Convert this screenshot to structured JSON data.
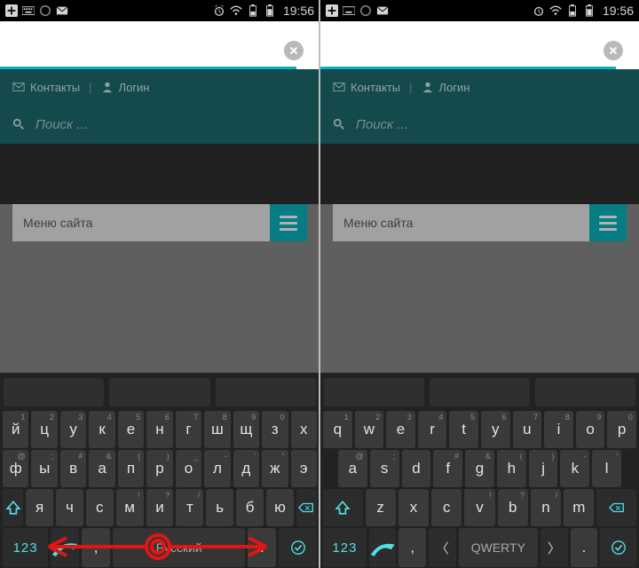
{
  "status": {
    "time": "19:56"
  },
  "browser": {
    "close": "×"
  },
  "teal": {
    "contacts": "Контакты",
    "login": "Логин",
    "search_placeholder": "Поиск ..."
  },
  "menu": {
    "label": "Меню сайта"
  },
  "left_keyboard": {
    "row1": [
      {
        "k": "й",
        "s": "1"
      },
      {
        "k": "ц",
        "s": "2"
      },
      {
        "k": "у",
        "s": "3"
      },
      {
        "k": "к",
        "s": "4"
      },
      {
        "k": "е",
        "s": "5"
      },
      {
        "k": "н",
        "s": "6"
      },
      {
        "k": "г",
        "s": "7"
      },
      {
        "k": "ш",
        "s": "8"
      },
      {
        "k": "щ",
        "s": "9"
      },
      {
        "k": "з",
        "s": "0"
      },
      {
        "k": "х",
        "s": ""
      }
    ],
    "row2": [
      {
        "k": "ф",
        "s": "@"
      },
      {
        "k": "ы",
        "s": ";"
      },
      {
        "k": "в",
        "s": "#"
      },
      {
        "k": "а",
        "s": "&"
      },
      {
        "k": "п",
        "s": "("
      },
      {
        "k": "р",
        "s": ")"
      },
      {
        "k": "о",
        "s": "_"
      },
      {
        "k": "л",
        "s": "-"
      },
      {
        "k": "д",
        "s": "'"
      },
      {
        "k": "ж",
        "s": "\""
      },
      {
        "k": "э",
        "s": ""
      }
    ],
    "row3": [
      {
        "k": "я",
        "s": ""
      },
      {
        "k": "ч",
        "s": ""
      },
      {
        "k": "с",
        "s": ""
      },
      {
        "k": "м",
        "s": "!"
      },
      {
        "k": "и",
        "s": "?"
      },
      {
        "k": "т",
        "s": "/"
      },
      {
        "k": "ь",
        "s": ""
      },
      {
        "k": "б",
        "s": ""
      },
      {
        "k": "ю",
        "s": ""
      }
    ],
    "num": "123",
    "space": "Русский",
    "comma": ",",
    "dot": "."
  },
  "right_keyboard": {
    "row1": [
      {
        "k": "q",
        "s": "1"
      },
      {
        "k": "w",
        "s": "2"
      },
      {
        "k": "e",
        "s": "3"
      },
      {
        "k": "r",
        "s": "4"
      },
      {
        "k": "t",
        "s": "5"
      },
      {
        "k": "y",
        "s": "6"
      },
      {
        "k": "u",
        "s": "7"
      },
      {
        "k": "i",
        "s": "8"
      },
      {
        "k": "o",
        "s": "9"
      },
      {
        "k": "p",
        "s": "0"
      }
    ],
    "row2": [
      {
        "k": "a",
        "s": "@"
      },
      {
        "k": "s",
        "s": ";"
      },
      {
        "k": "d",
        "s": ""
      },
      {
        "k": "f",
        "s": "#"
      },
      {
        "k": "g",
        "s": "&"
      },
      {
        "k": "h",
        "s": "("
      },
      {
        "k": "j",
        "s": ")"
      },
      {
        "k": "k",
        "s": "-"
      },
      {
        "k": "l",
        "s": "'"
      }
    ],
    "row3": [
      {
        "k": "z",
        "s": ""
      },
      {
        "k": "x",
        "s": ""
      },
      {
        "k": "c",
        "s": ""
      },
      {
        "k": "v",
        "s": "!"
      },
      {
        "k": "b",
        "s": "?"
      },
      {
        "k": "n",
        "s": "/"
      },
      {
        "k": "m",
        "s": ""
      }
    ],
    "num": "123",
    "space": "QWERTY",
    "comma": ",",
    "dot": ".",
    "chev_l": "〈",
    "chev_r": "〉"
  }
}
